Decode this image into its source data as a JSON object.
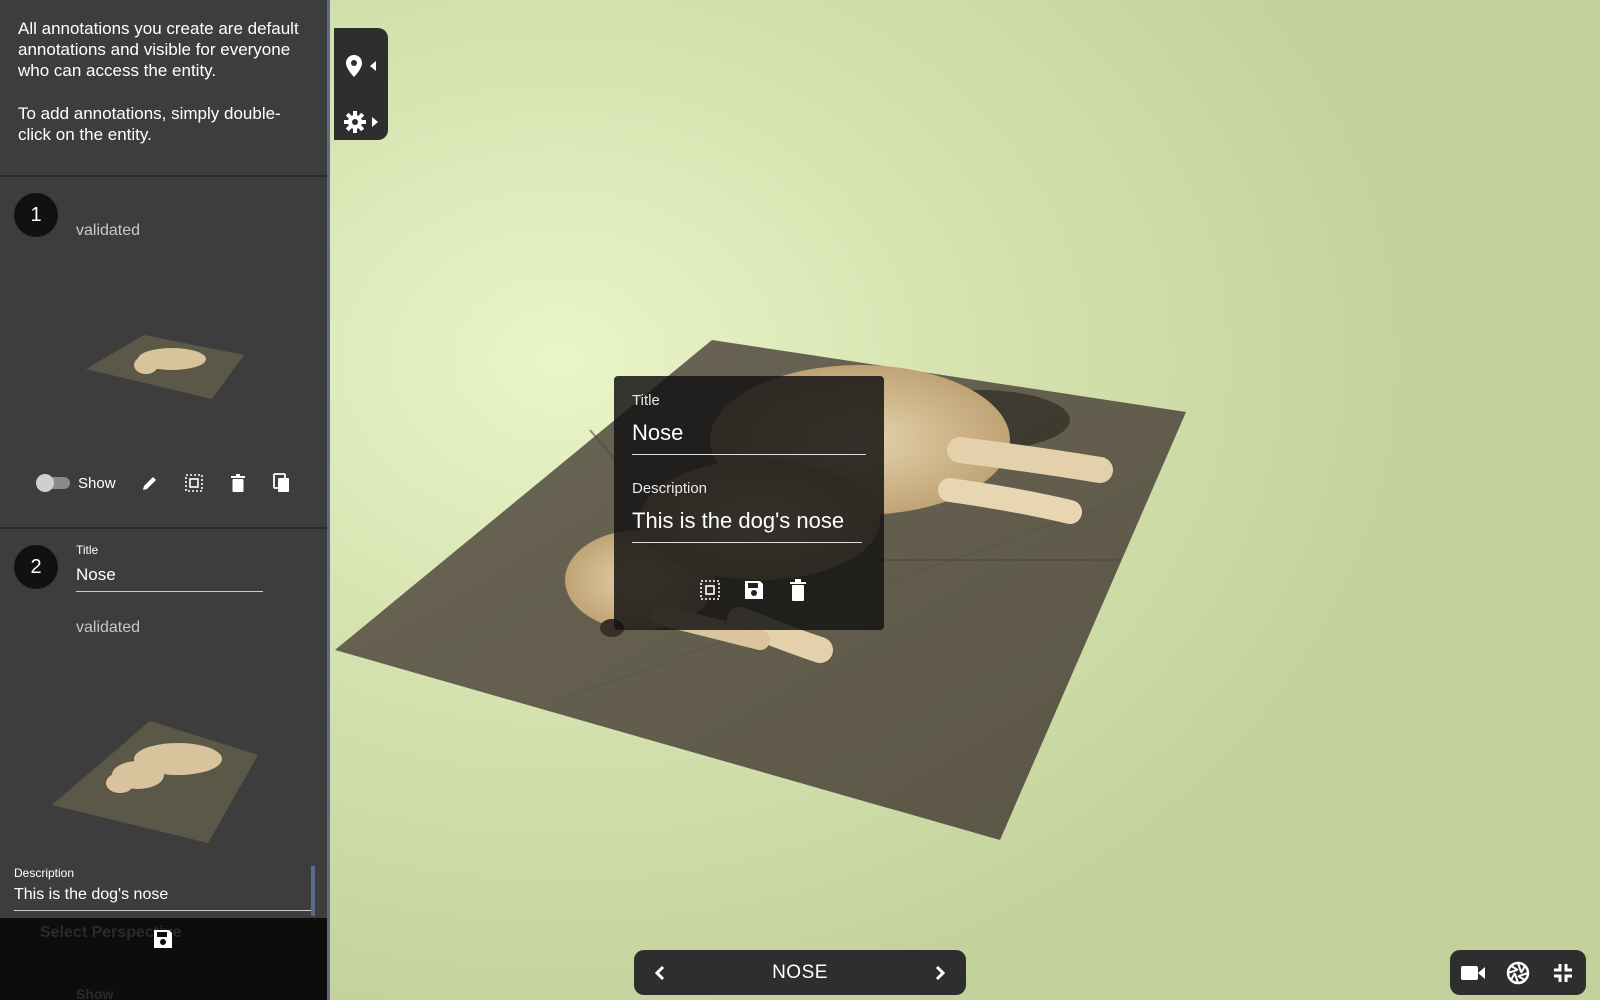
{
  "sidebar": {
    "intro_text_1": "All annotations you create are default annotations and visible for everyone who can access the entity.",
    "intro_text_2": "To add annotations, simply double-click on the entity.",
    "annotations": [
      {
        "number": "1",
        "status": "validated",
        "show_label": "Show"
      },
      {
        "number": "2",
        "title_label": "Title",
        "title_value": "Nose",
        "status": "validated",
        "description_label": "Description",
        "description_value": "This is the dog's nose"
      }
    ],
    "ghost_text_1": "Select Perspective",
    "ghost_text_2": "Show"
  },
  "popup": {
    "title_label": "Title",
    "title_value": "Nose",
    "description_label": "Description",
    "description_value": "This is the dog's nose"
  },
  "nav": {
    "current_annotation": "NOSE"
  },
  "colors": {
    "panel_bg": "#3d3d3d",
    "toolbar_bg": "#2e2e2e",
    "viewport_bg": "#d6e3b0",
    "accent_border": "#5a6a8a"
  },
  "icons": {
    "toolbar": [
      "map-marker-icon",
      "chevron-left-icon",
      "gear-icon",
      "chevron-right-icon"
    ],
    "card": [
      "toggle-icon",
      "pencil-icon",
      "select-area-icon",
      "trash-icon",
      "copy-icon"
    ],
    "popup": [
      "select-area-icon",
      "save-icon",
      "trash-icon"
    ],
    "view_controls": [
      "camera-icon",
      "aperture-icon",
      "compress-icon"
    ]
  }
}
